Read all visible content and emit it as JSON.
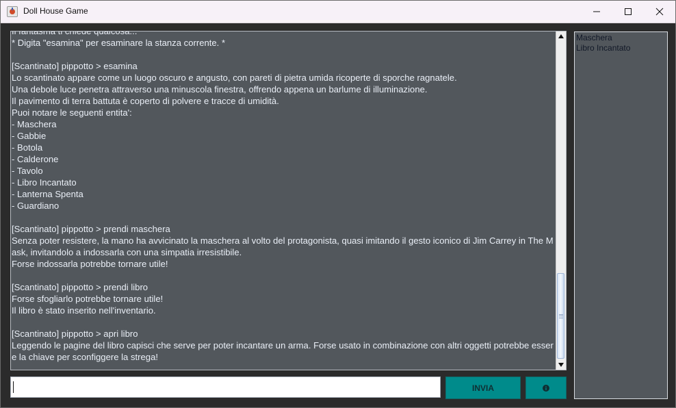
{
  "window": {
    "title": "Doll House Game",
    "controls": {
      "minimize_icon": "minimize-icon",
      "maximize_icon": "maximize-icon",
      "close_icon": "close-icon"
    }
  },
  "log": {
    "lines": [
      "Il fantasma ti chiede qualcosa...",
      "* Digita \"esamina\" per esaminare la stanza corrente. *",
      "",
      "[Scantinato] pippotto > esamina",
      "Lo scantinato appare come un luogo oscuro e angusto, con pareti di pietra umida ricoperte di sporche ragnatele.",
      "Una debole luce penetra attraverso una minuscola finestra, offrendo appena un barlume di illuminazione.",
      "Il pavimento di terra battuta è coperto di polvere e tracce di umidità.",
      "Puoi notare le seguenti entita':",
      "- Maschera",
      "- Gabbie",
      "- Botola",
      "- Calderone",
      "- Tavolo",
      "- Libro Incantato",
      "- Lanterna Spenta",
      "- Guardiano",
      "",
      "[Scantinato] pippotto > prendi maschera",
      "Senza poter resistere, la mano ha avvicinato la maschera al volto del protagonista, quasi imitando il gesto iconico di Jim Carrey in The Mask, invitandolo a indossarla con una simpatia irresistibile.",
      "Forse indossarla potrebbe tornare utile!",
      "",
      "[Scantinato] pippotto > prendi libro",
      "Forse sfogliarlo potrebbe tornare utile!",
      "Il libro è stato inserito nell'inventario.",
      "",
      "[Scantinato] pippotto > apri libro",
      "Leggendo le pagine del libro capisci che serve per poter incantare un arma. Forse usato in combinazione con altri oggetti potrebbe essere la chiave per sconfiggere la strega!"
    ],
    "scrollbar": {
      "up_icon": "triangle-up-icon",
      "down_icon": "triangle-down-icon"
    }
  },
  "command_input": {
    "value": "",
    "placeholder": ""
  },
  "send_button": {
    "label": "INVIA",
    "color": "#008b8b"
  },
  "info_button": {
    "icon": "info-icon"
  },
  "inventory": {
    "items": [
      "Maschera",
      "Libro Incantato"
    ]
  },
  "colors": {
    "panel_background": "#52575c",
    "text": "#e9eef6",
    "accent": "#008b8b"
  }
}
